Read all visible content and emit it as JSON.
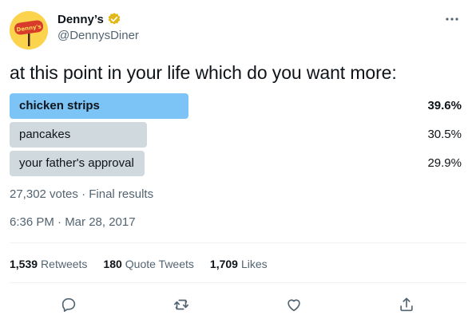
{
  "user": {
    "display_name": "Denny’s",
    "handle": "@DennysDiner",
    "avatar_logo_text": "Denny's",
    "verified": true
  },
  "tweet": {
    "text": "at this point in your life which do you want more:"
  },
  "poll": {
    "options": [
      {
        "label": "chicken strips",
        "percent_text": "39.6%",
        "percent": 39.6,
        "winner": true
      },
      {
        "label": "pancakes",
        "percent_text": "30.5%",
        "percent": 30.5,
        "winner": false
      },
      {
        "label": "your father's approval",
        "percent_text": "29.9%",
        "percent": 29.9,
        "winner": false
      }
    ],
    "votes_text": "27,302 votes · Final results"
  },
  "timestamp": "6:36 PM · Mar 28, 2017",
  "stats": {
    "retweets_count": "1,539",
    "retweets_label": "Retweets",
    "quotes_count": "180",
    "quotes_label": "Quote Tweets",
    "likes_count": "1,709",
    "likes_label": "Likes"
  },
  "icons": {
    "more": "more-horizontal-icon",
    "reply": "reply-icon",
    "retweet": "retweet-icon",
    "like": "heart-icon",
    "share": "share-icon",
    "verified": "verified-badge-icon"
  },
  "colors": {
    "winner_bar": "#7cc3f6",
    "other_bar": "#cfd9de",
    "text_primary": "#0f1419",
    "text_secondary": "#536471",
    "verified_gold": "#e2b719"
  }
}
